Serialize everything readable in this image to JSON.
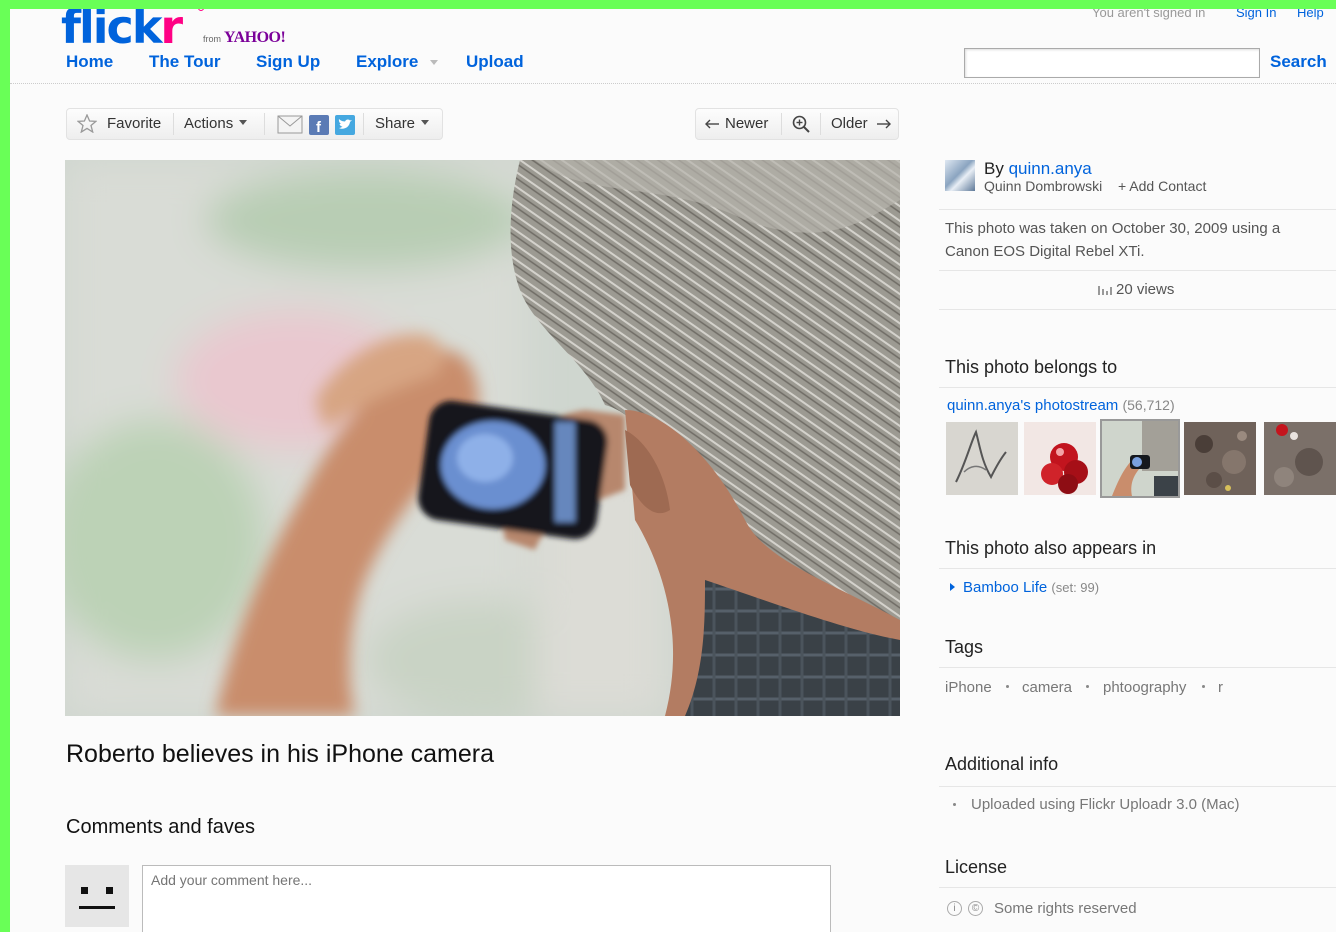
{
  "header": {
    "logo_word": "flick",
    "logo_r": "r",
    "from_label": "from",
    "yahoo_label": "YAHOO!",
    "auth_status": "You aren't signed in",
    "sign_in_label": "Sign In",
    "help_label": "Help",
    "nav": [
      "Home",
      "The Tour",
      "Sign Up",
      "Explore",
      "Upload"
    ],
    "search_label": "Search",
    "search_value": ""
  },
  "toolbar": {
    "favorite_label": "Favorite",
    "actions_label": "Actions",
    "share_label": "Share",
    "newer_label": "Newer",
    "older_label": "Older",
    "icons": [
      "star-icon",
      "email-icon",
      "facebook-icon",
      "twitter-icon",
      "zoom-icon",
      "arrow-left-icon",
      "arrow-right-icon"
    ]
  },
  "photo": {
    "title": "Roberto believes in his iPhone camera"
  },
  "comments": {
    "heading": "Comments and faves",
    "placeholder": "Add your comment here..."
  },
  "sidebar": {
    "by_prefix": "By",
    "owner_username": "quinn.anya",
    "owner_real_name": "Quinn Dombrowski",
    "add_contact_label": "+ Add Contact",
    "taken_text": "This photo was taken on October 30, 2009 using a Canon EOS Digital Rebel XTi.",
    "views_label": "20 views",
    "belongs_heading": "This photo belongs to",
    "photostream_link": "quinn.anya's photostream",
    "photostream_count": "(56,712)",
    "appears_heading": "This photo also appears in",
    "set_name": "Bamboo Life",
    "set_meta": "(set: 99)",
    "tags_heading": "Tags",
    "tags": [
      "iPhone",
      "camera",
      "phtoography",
      "r"
    ],
    "additional_heading": "Additional info",
    "uploaded_text": "Uploaded using Flickr Uploadr 3.0 (Mac)",
    "license_heading": "License",
    "license_text": "Some rights reserved"
  },
  "colors": {
    "flickr_blue": "#0063dc",
    "flickr_pink": "#ff0084",
    "outer_border": "#69ff57"
  }
}
